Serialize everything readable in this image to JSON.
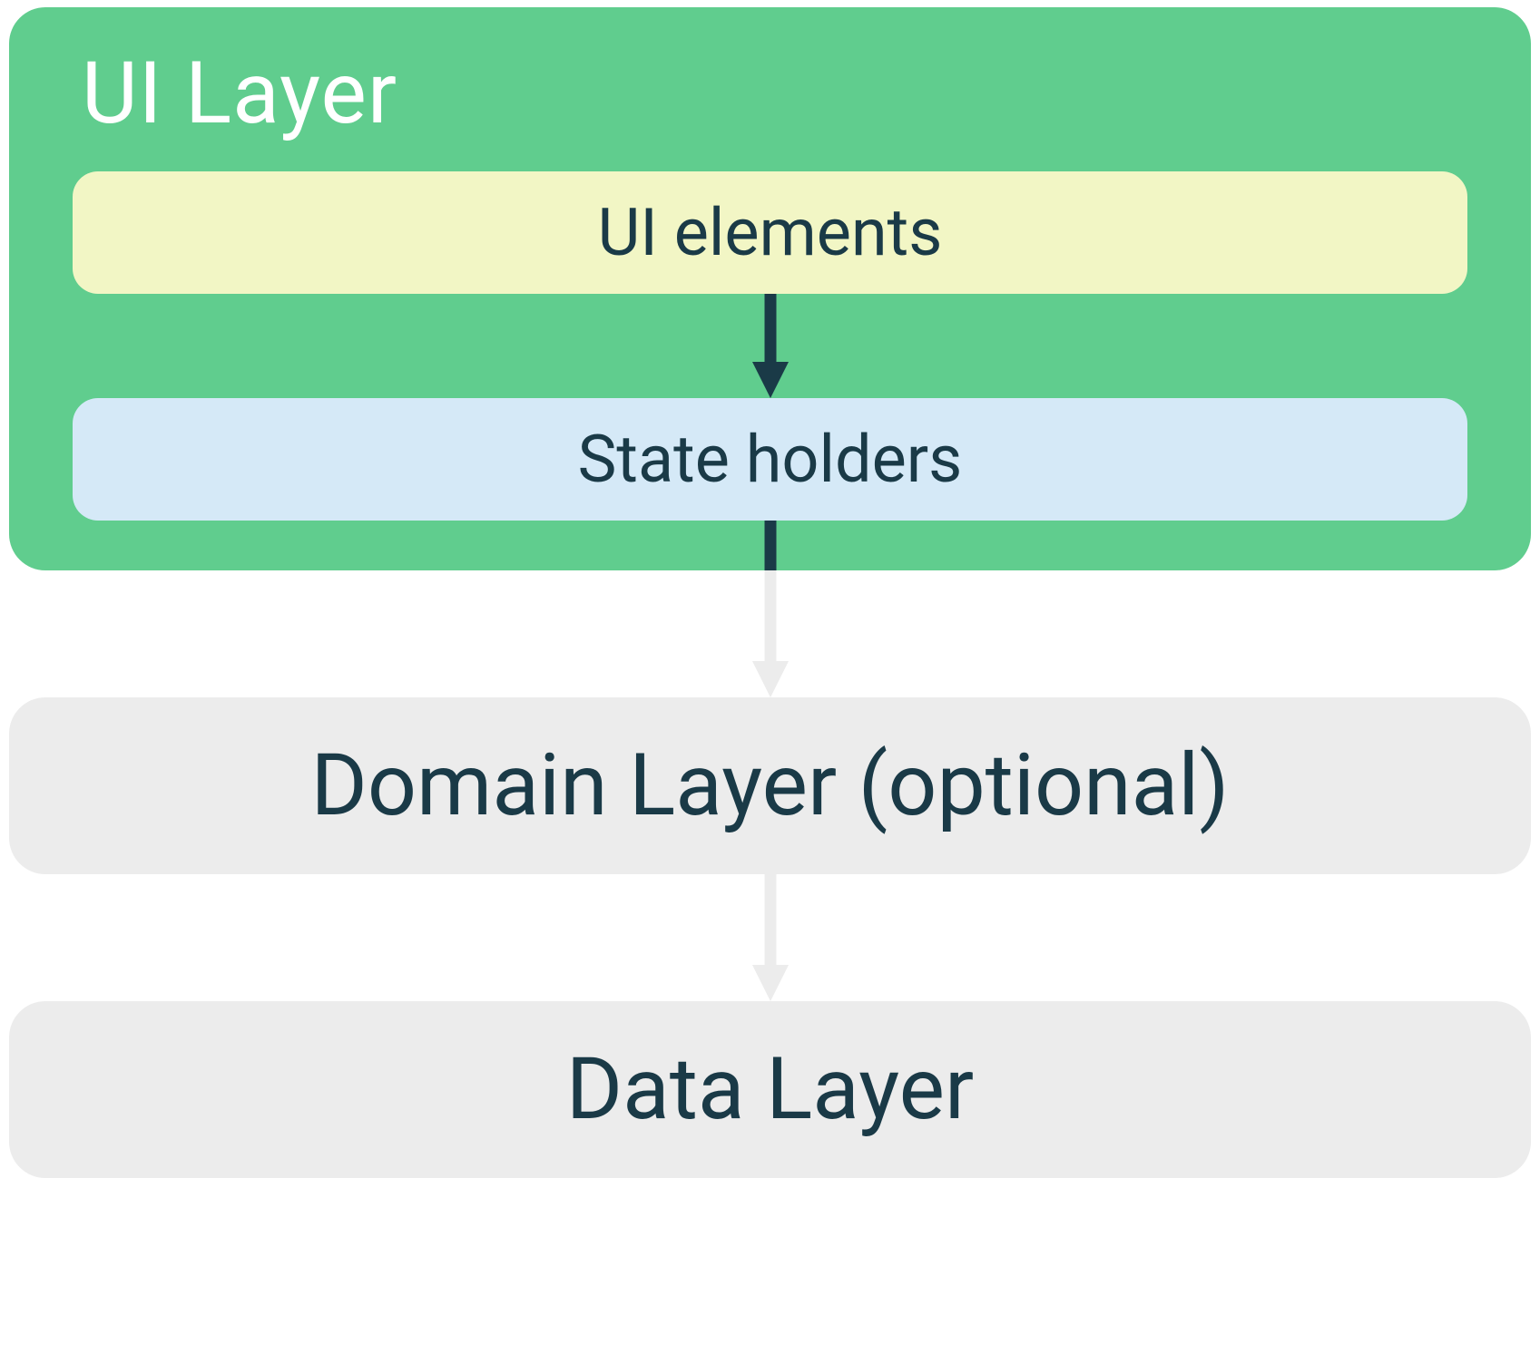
{
  "colors": {
    "ui_layer_bg": "#60cd8e",
    "ui_elements_bg": "#f2f6c5",
    "state_holders_bg": "#d5e9f7",
    "layer_box_bg": "#ececec",
    "text_dark": "#1a3a47",
    "text_white": "#ffffff",
    "arrow_dark": "#1a3a47",
    "arrow_light": "#ececec"
  },
  "diagram": {
    "ui_layer": {
      "title": "UI Layer",
      "boxes": {
        "ui_elements": "UI elements",
        "state_holders": "State holders"
      }
    },
    "domain_layer": "Domain Layer (optional)",
    "data_layer": "Data Layer"
  }
}
